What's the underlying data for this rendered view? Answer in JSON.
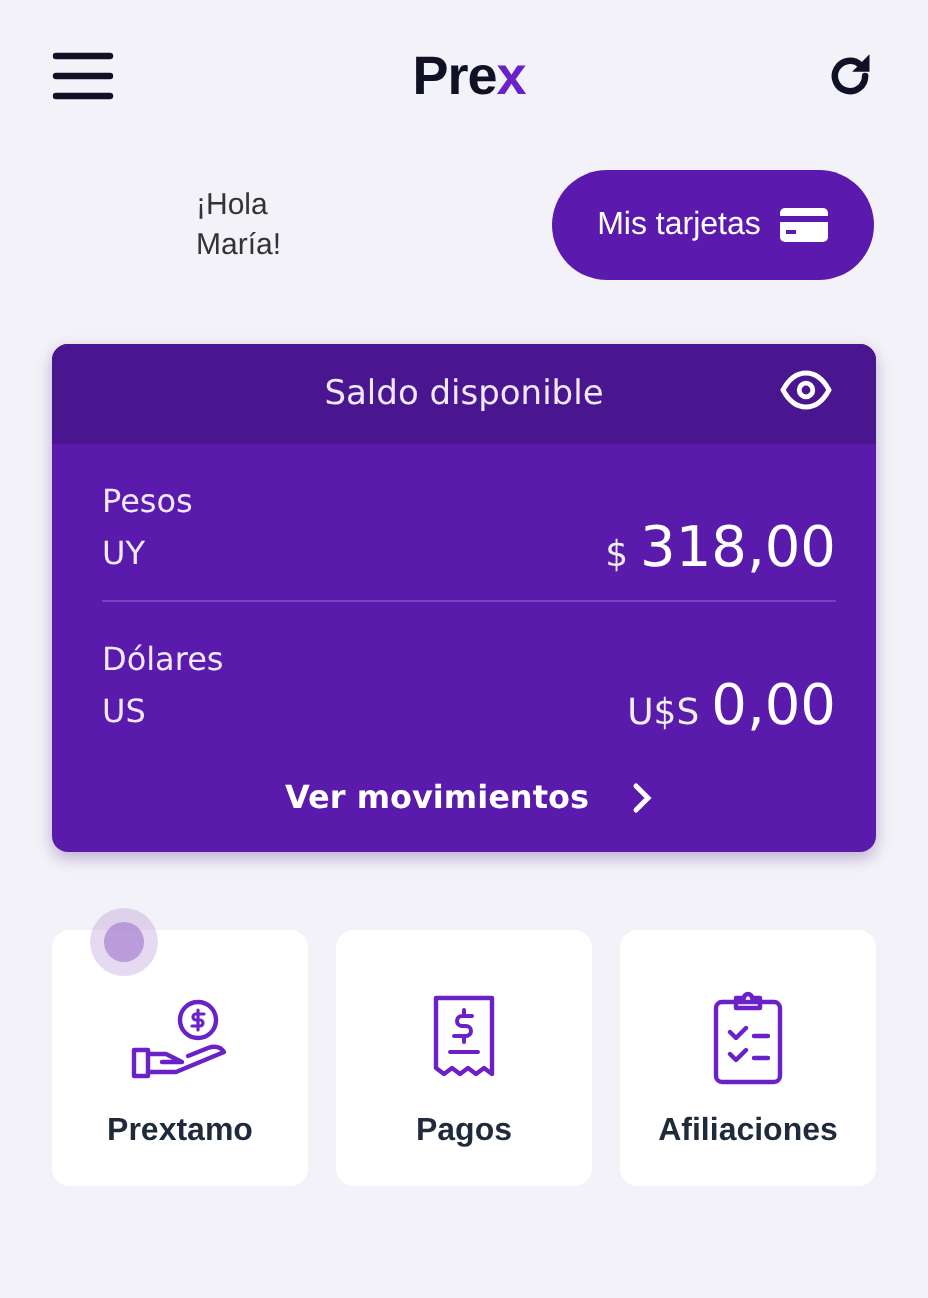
{
  "header": {
    "logo": {
      "main": "Pre",
      "accent": "x"
    }
  },
  "greeting": {
    "lines": [
      "¡Hola",
      "María!"
    ]
  },
  "cards_button": {
    "label": "Mis tarjetas"
  },
  "balance": {
    "title": "Saldo disponible",
    "accounts": [
      {
        "name": "Pesos",
        "code": "UY",
        "symbol": "$",
        "amount": "318,00"
      },
      {
        "name": "Dólares",
        "code": "US",
        "symbol": "U$S",
        "amount": "0,00"
      }
    ],
    "link": "Ver movimientos"
  },
  "tiles": [
    {
      "kind": "loan",
      "label": "Prextamo",
      "touched": true
    },
    {
      "kind": "payments",
      "label": "Pagos",
      "touched": false
    },
    {
      "kind": "affiliations",
      "label": "Afiliaciones",
      "touched": false
    }
  ]
}
